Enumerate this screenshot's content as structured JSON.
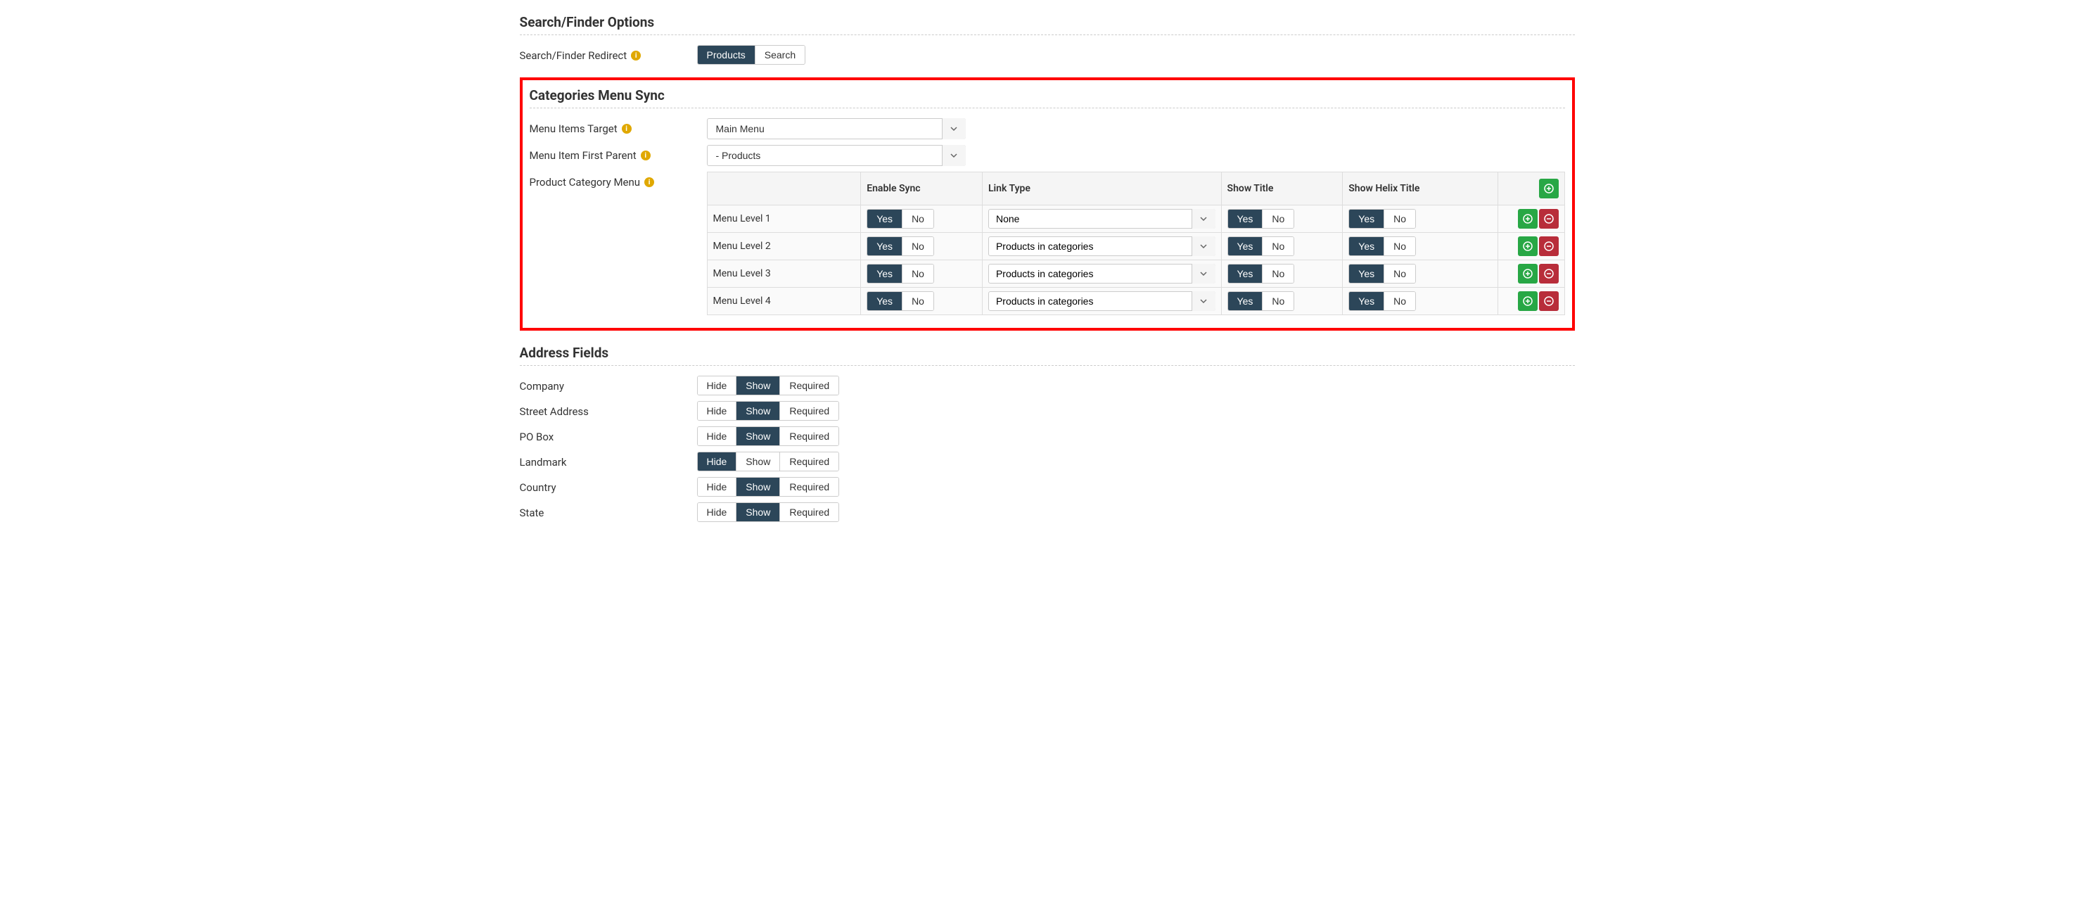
{
  "searchFinder": {
    "title": "Search/Finder Options",
    "redirectLabel": "Search/Finder Redirect",
    "options": {
      "products": "Products",
      "search": "Search"
    }
  },
  "categoriesSync": {
    "title": "Categories Menu Sync",
    "menuItemsTargetLabel": "Menu Items Target",
    "menuItemsTargetValue": "Main Menu",
    "menuItemFirstParentLabel": "Menu Item First Parent",
    "menuItemFirstParentValue": "- Products",
    "productCategoryMenuLabel": "Product Category Menu",
    "table": {
      "headers": {
        "enableSync": "Enable Sync",
        "linkType": "Link Type",
        "showTitle": "Show Title",
        "showHelixTitle": "Show Helix Title"
      },
      "yesNo": {
        "yes": "Yes",
        "no": "No"
      },
      "linkOptions": {
        "none": "None",
        "productsInCategories": "Products in categories"
      },
      "rows": [
        {
          "name": "Menu Level 1",
          "enableSync": "yes",
          "linkType": "none",
          "showTitle": "yes",
          "showHelixTitle": "yes"
        },
        {
          "name": "Menu Level 2",
          "enableSync": "yes",
          "linkType": "productsInCategories",
          "showTitle": "yes",
          "showHelixTitle": "yes"
        },
        {
          "name": "Menu Level 3",
          "enableSync": "yes",
          "linkType": "productsInCategories",
          "showTitle": "yes",
          "showHelixTitle": "yes"
        },
        {
          "name": "Menu Level 4",
          "enableSync": "yes",
          "linkType": "productsInCategories",
          "showTitle": "yes",
          "showHelixTitle": "yes"
        }
      ]
    }
  },
  "addressFields": {
    "title": "Address Fields",
    "options": {
      "hide": "Hide",
      "show": "Show",
      "required": "Required"
    },
    "rows": [
      {
        "label": "Company",
        "value": "show"
      },
      {
        "label": "Street Address",
        "value": "show"
      },
      {
        "label": "PO Box",
        "value": "show"
      },
      {
        "label": "Landmark",
        "value": "hide"
      },
      {
        "label": "Country",
        "value": "show"
      },
      {
        "label": "State",
        "value": "show"
      }
    ]
  }
}
